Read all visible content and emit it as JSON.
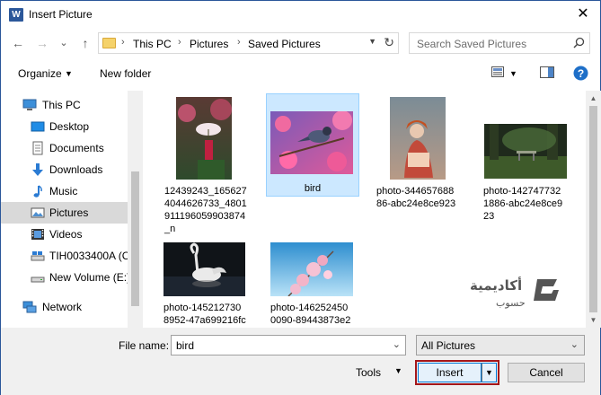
{
  "window": {
    "title": "Insert Picture",
    "app_icon_letter": "W",
    "close_glyph": "✕"
  },
  "nav": {
    "back_glyph": "←",
    "forward_glyph": "→",
    "recent_glyph": "⌄",
    "up_glyph": "↑",
    "breadcrumb": [
      "This PC",
      "Pictures",
      "Saved Pictures"
    ],
    "separator": "›",
    "search_placeholder": "Search Saved Pictures"
  },
  "toolbar": {
    "organize_label": "Organize",
    "new_folder_label": "New folder",
    "help_label": "?"
  },
  "sidebar": {
    "items": [
      {
        "label": "This PC",
        "icon": "computer-icon",
        "indent": false,
        "selected": false
      },
      {
        "label": "Desktop",
        "icon": "desktop-icon",
        "indent": true,
        "selected": false
      },
      {
        "label": "Documents",
        "icon": "documents-icon",
        "indent": true,
        "selected": false
      },
      {
        "label": "Downloads",
        "icon": "downloads-icon",
        "indent": true,
        "selected": false
      },
      {
        "label": "Music",
        "icon": "music-icon",
        "indent": true,
        "selected": false
      },
      {
        "label": "Pictures",
        "icon": "pictures-icon",
        "indent": true,
        "selected": true
      },
      {
        "label": "Videos",
        "icon": "videos-icon",
        "indent": true,
        "selected": false
      },
      {
        "label": "TIH0033400A (C:",
        "icon": "drive-c-icon",
        "indent": true,
        "selected": false
      },
      {
        "label": "New Volume (E:)",
        "icon": "drive-e-icon",
        "indent": true,
        "selected": false
      },
      {
        "label": "Network",
        "icon": "network-icon",
        "indent": false,
        "selected": false
      }
    ]
  },
  "files": [
    {
      "name": "12439243_1656274044626733_4801911196059903874_n",
      "display": [
        "12439243_165627",
        "4044626733_4801",
        "911196059903874",
        "_n"
      ],
      "thumb": "geisha-umbrella"
    },
    {
      "name": "bird",
      "display": [
        "bird"
      ],
      "thumb": "bird-blossom",
      "selected": true
    },
    {
      "name": "photo-34465768886-abc24e8ce923",
      "display": [
        "photo-344657688",
        "86-abc24e8ce923"
      ],
      "thumb": "sitting-woman"
    },
    {
      "name": "photo-1427477321886-abc24e8ce923",
      "display": [
        "photo-142747732",
        "1886-abc24e8ce9",
        "23"
      ],
      "thumb": "park-bench"
    },
    {
      "name": "photo-1452127308952-47a699216fc",
      "display": [
        "photo-145212730",
        "8952-47a699216fc"
      ],
      "thumb": "swan"
    },
    {
      "name": "photo-1462524500090-89443873e2",
      "display": [
        "photo-146252450",
        "0090-89443873e2"
      ],
      "thumb": "pink-blossom"
    }
  ],
  "watermark": {
    "line1": "أكاديمية",
    "line2": "حسوب"
  },
  "bottom": {
    "file_name_label": "File name:",
    "file_name_value": "bird",
    "filter_value": "All Pictures",
    "tools_label": "Tools",
    "insert_label": "Insert",
    "cancel_label": "Cancel"
  }
}
